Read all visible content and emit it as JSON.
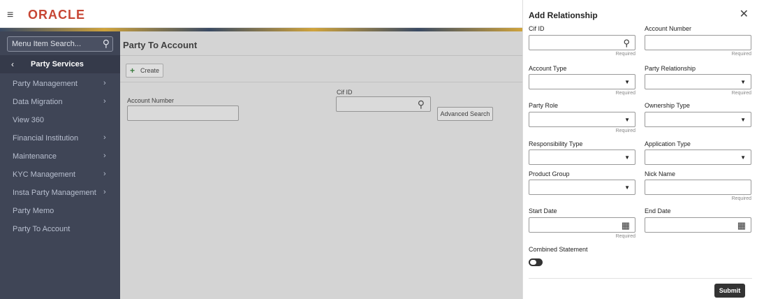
{
  "header": {
    "brand": "ORACLE",
    "menu_icon": "hamburger-icon"
  },
  "sidebar": {
    "search_placeholder": "Menu Item Search...",
    "back_label": "Party Services",
    "items": [
      {
        "label": "Party Management",
        "has_arrow": true
      },
      {
        "label": "Data Migration",
        "has_arrow": true
      },
      {
        "label": "View 360",
        "has_arrow": false
      },
      {
        "label": "Financial Institution",
        "has_arrow": true
      },
      {
        "label": "Maintenance",
        "has_arrow": true
      },
      {
        "label": "KYC Management",
        "has_arrow": true
      },
      {
        "label": "Insta Party Management",
        "has_arrow": true
      },
      {
        "label": "Party Memo",
        "has_arrow": false
      },
      {
        "label": "Party To Account",
        "has_arrow": false
      }
    ]
  },
  "main": {
    "title": "Party To Account",
    "create_label": "Create",
    "account_number_label": "Account Number",
    "cif_id_label": "Cif ID",
    "advanced_search_label": "Advanced Search"
  },
  "drawer": {
    "title": "Add Relationship",
    "required_text": "Required",
    "fields": {
      "cif_id": "Cif ID",
      "account_number": "Account Number",
      "account_type": "Account Type",
      "party_relationship": "Party Relationship",
      "party_role": "Party Role",
      "ownership_type": "Ownership Type",
      "responsibility_type": "Responsibility Type",
      "application_type": "Application Type",
      "product_group": "Product Group",
      "nick_name": "Nick Name",
      "start_date": "Start Date",
      "end_date": "End Date",
      "combined_statement": "Combined Statement"
    },
    "submit_label": "Submit"
  }
}
